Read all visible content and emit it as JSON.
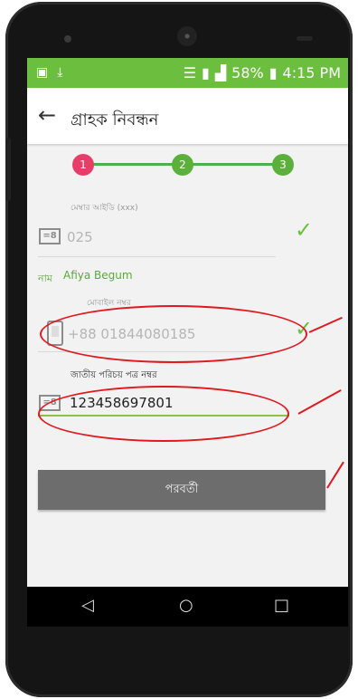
{
  "status_bar": {
    "battery": "58%",
    "time": "4:15 PM",
    "icons": [
      "screenshot-icon",
      "download-icon",
      "wifi-icon",
      "sim-icon",
      "signal-icon",
      "battery-icon"
    ]
  },
  "app_bar": {
    "title": "গ্রাহক নিবন্ধন"
  },
  "stepper": {
    "steps": [
      "1",
      "2",
      "3"
    ],
    "active_step": 1
  },
  "form": {
    "member_id_label": "মেম্বার আইডি (xxx)",
    "member_id_value": "025",
    "name_label": "নাম",
    "name_value": "Afiya Begum",
    "mobile_label": "মোবাইল নম্বর",
    "mobile_value": "+88 01844080185",
    "nid_label": "জাতীয় পরিচয় পত্র নম্বর",
    "nid_value": "123458697801",
    "next_button": "পরবর্তী"
  },
  "colors": {
    "status_green": "#6cbf3e",
    "step1_pink": "#e53e6b",
    "step_green": "#5bb03c",
    "button_gray": "#6d6d6d",
    "annotation_red": "#e0191f"
  }
}
